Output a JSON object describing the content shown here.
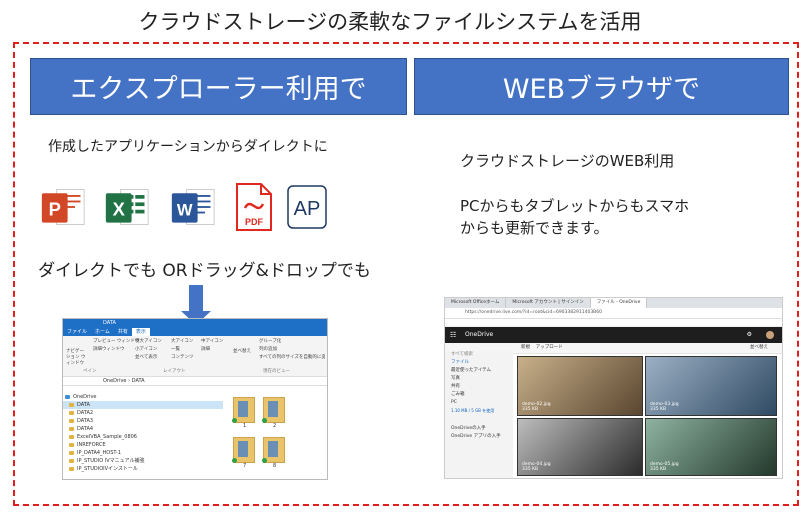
{
  "title": "クラウドストレージの柔軟なファイルシステムを活用",
  "left": {
    "header": "エクスプローラー利用で",
    "desc": "作成したアプリケーションからダイレクトに",
    "apps": [
      {
        "name": "PowerPoint",
        "letter": "P",
        "color": "#d24726"
      },
      {
        "name": "Excel",
        "letter": "X",
        "color": "#217346"
      },
      {
        "name": "Word",
        "letter": "W",
        "color": "#2b579a"
      },
      {
        "name": "PDF",
        "letter": "PDF",
        "color": "#e0281f"
      },
      {
        "name": "AP",
        "letter": "AP",
        "color": "#1f3864"
      }
    ],
    "drag_text": "ダイレクトでも ORドラッグ&ドロップでも"
  },
  "right": {
    "header": "WEBブラウザで",
    "line1": "クラウドストレージのWEB利用",
    "line2": "PCからもタブレットからもスマホ",
    "line3": "からも更新できます。"
  },
  "explorer": {
    "window_title": "DATA",
    "tabs": [
      "ファイル",
      "ホーム",
      "共有",
      "表示"
    ],
    "active_tab": 3,
    "ribbon": [
      "ナビゲーション ウィンドウ",
      "プレビュー ウィンドウ",
      "詳細ウィンドウ",
      "特大アイコン",
      "大アイコン",
      "中アイコン",
      "小アイコン",
      "一覧",
      "詳細",
      "並べて表示",
      "コンテンツ",
      "並べ替え",
      "グループ化",
      "列の追加",
      "すべての列のサイズを自動的に変更する",
      "ペイン",
      "レイアウト",
      "現在のビュー"
    ],
    "address": "OneDrive › DATA",
    "tree": [
      "OneDrive",
      "DATA",
      "DATA2",
      "DATA3",
      "DATA4",
      "ExcelVBA_Sample_0806",
      "INREFORCE",
      "IP_DATA4_HOST-1",
      "IP_STUDIO IVマニュアル補強",
      "IP_STUDIOIVインストール"
    ],
    "selected": 1,
    "file_labels": [
      "1",
      "2",
      "4",
      "5",
      "7",
      "8"
    ]
  },
  "browser": {
    "tabs": [
      "Microsoft Officeホーム",
      "Microsoft アカウント | サインイン",
      "ファイル - OneDrive"
    ],
    "address": "https://onedrive.live.com/?id=root&cid=6903382911403B60",
    "app_title": "OneDrive",
    "cmd": [
      "新規",
      "アップロード"
    ],
    "sort": "並べ替え",
    "nav": [
      "すべて検索",
      "ファイル",
      "最近使ったアイテム",
      "写真",
      "共有",
      "ごみ箱",
      "PC",
      "1.10 MB / 5 GB を使用",
      "OneDriveの入手",
      "OneDrive アプリの入手"
    ],
    "photos": [
      {
        "name": "demo-02.jpg",
        "size": "335 KB",
        "bg": "#8a6b4a"
      },
      {
        "name": "demo-03.jpg",
        "size": "335 KB",
        "bg": "#4a6a8a"
      },
      {
        "name": "demo-04.jpg",
        "size": "335 KB",
        "bg": "#6b6b6b"
      },
      {
        "name": "demo-05.jpg",
        "size": "335 KB",
        "bg": "#3a5a4a"
      }
    ]
  }
}
